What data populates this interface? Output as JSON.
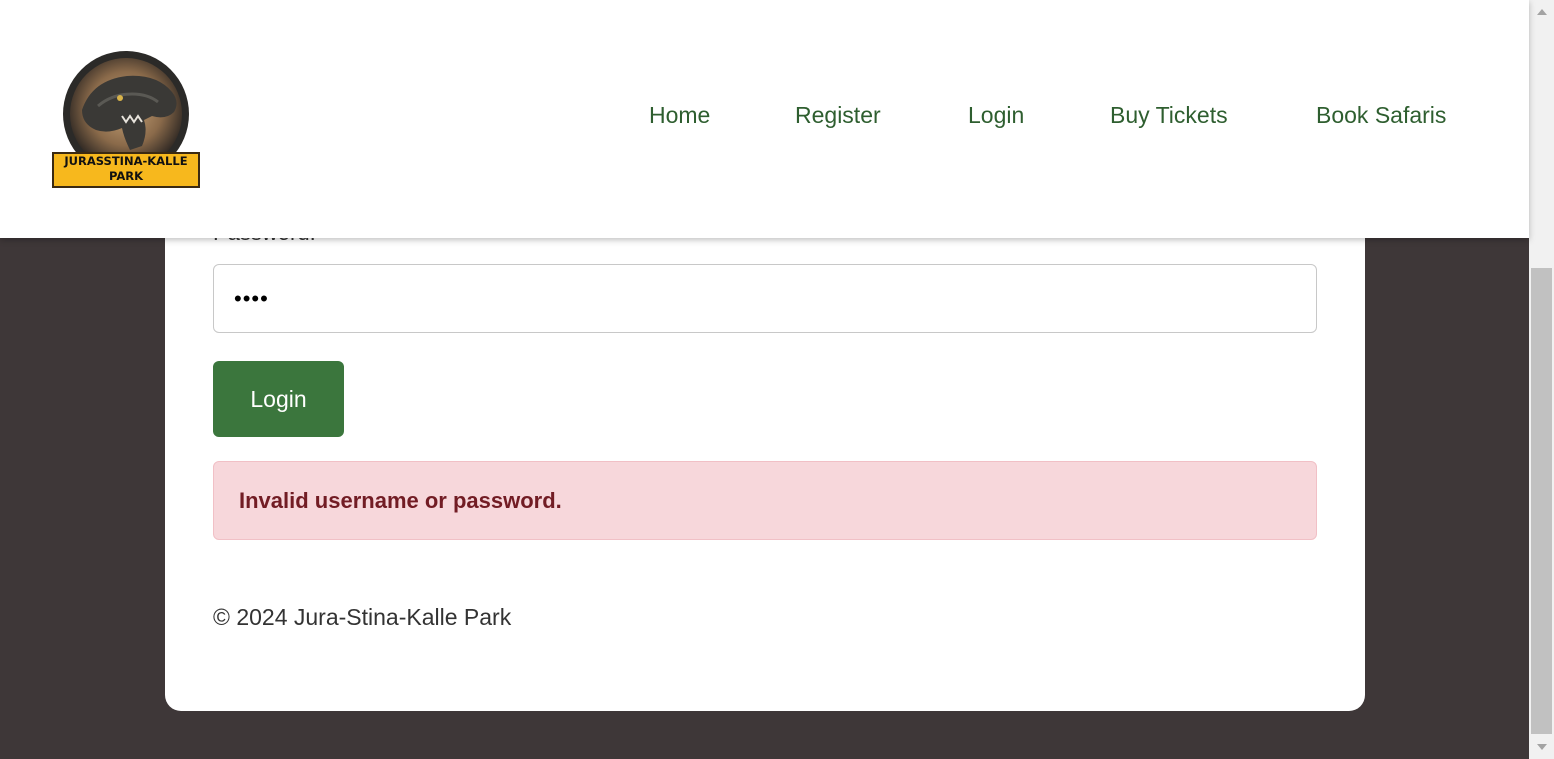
{
  "header": {
    "logo": {
      "text_line1": "JURASSTINA-KALLE",
      "text_line2": "PARK"
    },
    "nav": [
      {
        "label": "Home"
      },
      {
        "label": "Register"
      },
      {
        "label": "Login"
      },
      {
        "label": "Buy Tickets"
      },
      {
        "label": "Book Safaris"
      }
    ]
  },
  "form": {
    "password_label": "Password:",
    "password_value": "••••",
    "login_button": "Login",
    "error_message": "Invalid username or password."
  },
  "footer": {
    "text": "© 2024 Jura-Stina-Kalle Park"
  },
  "colors": {
    "nav_text": "#2e5e2f",
    "button_bg": "#3b763d",
    "error_bg": "#f7d7db",
    "error_text": "#721c24",
    "page_bg": "#3e3738"
  },
  "icons": {
    "logo": "dinosaur-logo-icon",
    "scroll_up": "chevron-up-icon",
    "scroll_down": "chevron-down-icon"
  }
}
